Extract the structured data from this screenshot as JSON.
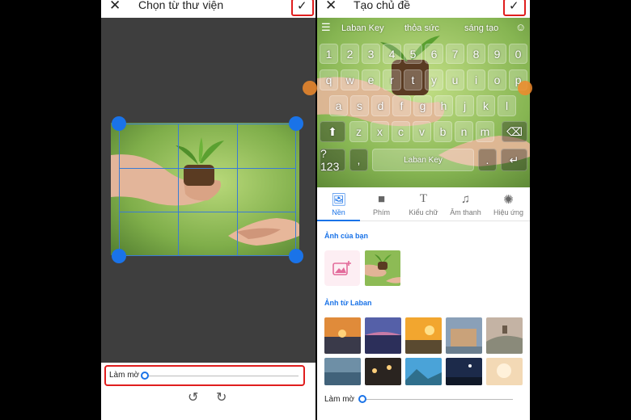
{
  "left_screen": {
    "title": "Chọn từ thư viện",
    "close_glyph": "✕",
    "confirm_glyph": "✓",
    "blur_label": "Làm mờ",
    "rotate_left_glyph": "↺",
    "rotate_right_glyph": "↻"
  },
  "right_screen": {
    "title": "Tạo chủ đề",
    "close_glyph": "✕",
    "confirm_glyph": "✓",
    "keyboard": {
      "menu_glyph": "☰",
      "suggestions": [
        "Laban Key",
        "thỏa sức",
        "sáng tạo"
      ],
      "emoji_glyph": "☺",
      "row_numbers": [
        "1",
        "2",
        "3",
        "4",
        "5",
        "6",
        "7",
        "8",
        "9",
        "0"
      ],
      "row_top": [
        "q",
        "w",
        "e",
        "r",
        "t",
        "y",
        "u",
        "i",
        "o",
        "p"
      ],
      "row_mid": [
        "a",
        "s",
        "d",
        "f",
        "g",
        "h",
        "j",
        "k",
        "l"
      ],
      "row_bottom": [
        "z",
        "x",
        "c",
        "v",
        "b",
        "n",
        "m"
      ],
      "shift_glyph": "⬆",
      "backspace_glyph": "⌫",
      "symbols_key": "?123",
      "space_label": "Laban Key",
      "enter_glyph": "↵"
    },
    "tabs": [
      {
        "label": "Nền",
        "icon": "image-icon",
        "glyph": "🖼",
        "active": true
      },
      {
        "label": "Phím",
        "icon": "key-square-icon",
        "glyph": "■",
        "active": false
      },
      {
        "label": "Kiểu chữ",
        "icon": "font-icon",
        "glyph": "T",
        "active": false
      },
      {
        "label": "Âm thanh",
        "icon": "music-note-icon",
        "glyph": "♫",
        "active": false
      },
      {
        "label": "Hiệu ứng",
        "icon": "sparkle-icon",
        "glyph": "✺",
        "active": false
      }
    ],
    "section_your_photos": "Ảnh của bạn",
    "section_laban_photos": "Ảnh từ Laban",
    "blur_label": "Làm mờ"
  },
  "colors": {
    "accent": "#1a73e8",
    "highlight_border": "#e01e1e",
    "crop_grid": "#3a7bd5",
    "canvas_bg": "#3e3e3e"
  }
}
